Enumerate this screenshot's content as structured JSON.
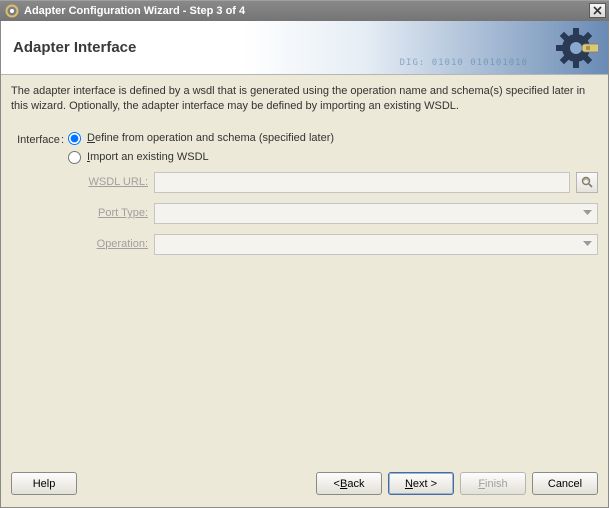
{
  "title": "Adapter Configuration Wizard - Step 3 of 4",
  "banner": {
    "title": "Adapter Interface",
    "deco": "DIG: 01010 010101010"
  },
  "description": "The adapter interface is defined by a wsdl that is generated using the operation name and schema(s) specified later in this wizard.  Optionally, the adapter interface may be defined by importing an existing WSDL.",
  "form": {
    "interface_label": "Interface",
    "radio1_pre": "D",
    "radio1_rest": "efine from operation and schema (specified later)",
    "radio2_pre": "I",
    "radio2_rest": "mport an existing WSDL",
    "wsdl_pre": "W",
    "wsdl_rest": "SDL URL:",
    "wsdl_value": "",
    "porttype_pre": "P",
    "porttype_rest": "ort Type:",
    "porttype_value": "",
    "operation_pre": "O",
    "operation_rest": "peration:",
    "operation_value": ""
  },
  "buttons": {
    "help": "Help",
    "back_lt": "< ",
    "back_u": "B",
    "back_rest": "ack",
    "next_u": "N",
    "next_rest": "ext >",
    "finish_u": "F",
    "finish_rest": "inish",
    "cancel": "Cancel"
  }
}
